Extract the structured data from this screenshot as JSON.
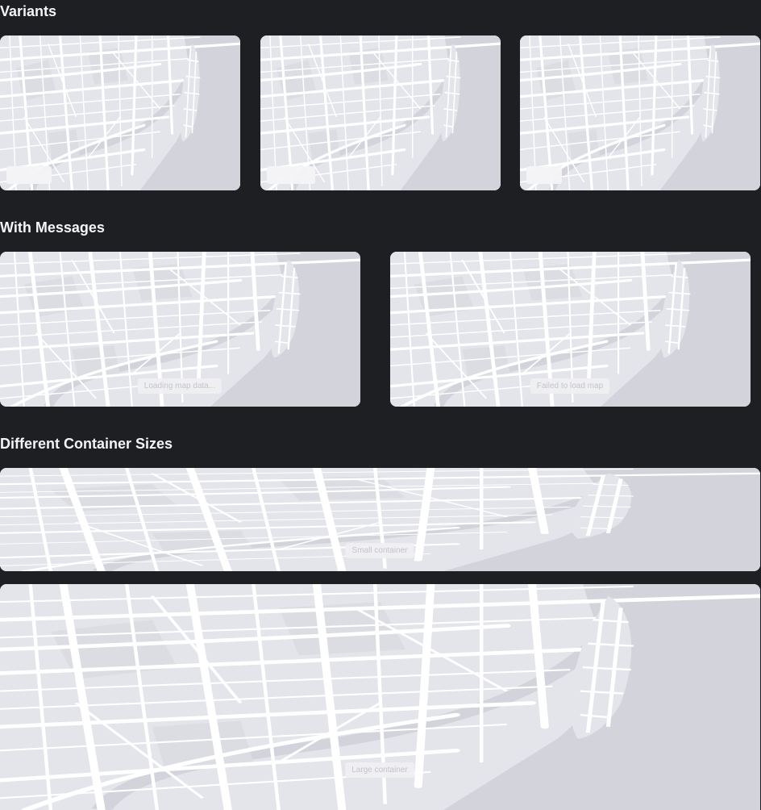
{
  "sections": {
    "variants": {
      "title": "Variants"
    },
    "messages": {
      "title": "With Messages",
      "loading_text": "Loading map data...",
      "error_text": "Failed to load map"
    },
    "sizes": {
      "title": "Different Container Sizes",
      "small_text": "Small container",
      "large_text": "Large container"
    }
  },
  "colors": {
    "page_background": "#1e1f23",
    "map_land": "#e4e5ea",
    "map_water": "#d3d4db",
    "map_road": "#ffffff",
    "title_text": "#f4f4f6"
  },
  "icons": []
}
